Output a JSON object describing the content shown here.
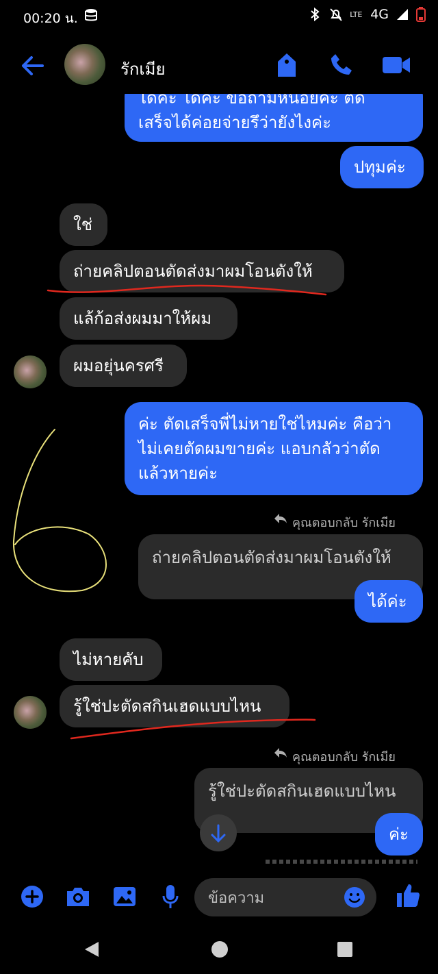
{
  "status_bar": {
    "time": "00:20 น.",
    "network": "4G",
    "lte": "LTE"
  },
  "header": {
    "contact_name": "รักเมีย"
  },
  "messages": {
    "m1_lines": [
      "ได้ค่ะ ได้ค่ะ ขอถามหน่อยค่ะ ตัด",
      "เสร็จได้ค่อยจ่ายรึว่ายังไงค่ะ"
    ],
    "m2": "ปทุมค่ะ",
    "m3": "ใช่",
    "m4": "ถ่ายคลิปตอนตัดส่งมาผมโอนตังให้",
    "m5": "แล้ก้อส่งผมมาให้ผม",
    "m6": "ผมอยุ่นครศรี",
    "m7_lines": [
      "ค่ะ ตัดเสร็จพี่ไม่หายใช่ไหมค่ะ คือว่า",
      "ไม่เคยตัดผมขายค่ะ แอบกลัวว่าตัด",
      "แล้วหายค่ะ"
    ],
    "reply_label_1": "คุณตอบกลับ รักเมีย",
    "reply_quote_1": "ถ่ายคลิปตอนตัดส่งมาผมโอนตังให้",
    "m8": "ได้ค่ะ",
    "m9": "ไม่หายคับ",
    "m10": "รู้ใช่ปะตัดสกินเฮดแบบไหน",
    "reply_label_2": "คุณตอบกลับ รักเมีย",
    "reply_quote_2": "รู้ใช่ปะตัดสกินเฮดแบบไหน",
    "m11": "ค่ะ"
  },
  "composer": {
    "placeholder": "ข้อความ"
  },
  "colors": {
    "accent": "#2e68f5",
    "incoming_bubble": "#2b2b2b",
    "annotation_red": "#e0281e",
    "annotation_yellow": "#e8e07a"
  },
  "icons": {
    "header": [
      "back-arrow-icon",
      "tag-icon",
      "phone-icon",
      "video-camera-icon"
    ],
    "composer": [
      "plus-icon",
      "camera-icon",
      "image-icon",
      "microphone-icon",
      "emoji-icon",
      "thumbs-up-icon"
    ],
    "nav": [
      "back-triangle-icon",
      "home-circle-icon",
      "recents-square-icon"
    ]
  }
}
